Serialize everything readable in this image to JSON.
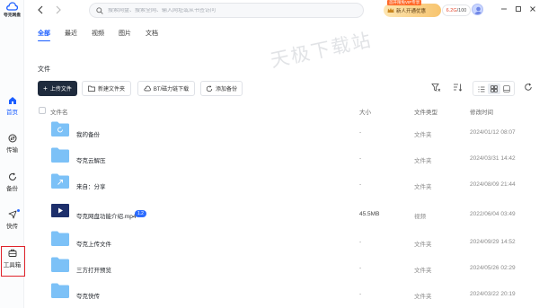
{
  "app": {
    "logo_text": "夸克网盘"
  },
  "sidebar": {
    "items": [
      {
        "label": "首页",
        "icon": "home-icon",
        "active": true
      },
      {
        "label": "传输",
        "icon": "transfer-icon"
      },
      {
        "label": "备份",
        "icon": "backup-icon"
      },
      {
        "label": "快传",
        "icon": "quick-send-icon"
      },
      {
        "label": "工具箱",
        "icon": "toolbox-icon"
      }
    ]
  },
  "topbar": {
    "search_placeholder": "搜索网盘、搜索全网、输入网址或从书签访问",
    "promo_tag": "首开限免VIP专享",
    "promo_label": "新人开通优惠",
    "storage_used": "6.2G",
    "storage_total": "/100"
  },
  "tabs": [
    "全部",
    "最近",
    "视频",
    "图片",
    "文档"
  ],
  "watermark": "天极下载站",
  "section_title": "文件",
  "actions": {
    "upload": "上传文件",
    "new_folder": "新建文件夹",
    "bt_download": "BT/磁力链下载",
    "add_backup": "添加备份"
  },
  "table": {
    "headers": {
      "name": "文件名",
      "size": "大小",
      "type": "文件类型",
      "time": "修改时间"
    },
    "rows": [
      {
        "name": "我的备份",
        "size": "-",
        "type": "文件夹",
        "time": "2024/01/12 08:07",
        "icon": "backup-folder-icon"
      },
      {
        "name": "夸克云解压",
        "size": "-",
        "type": "文件夹",
        "time": "2024/03/31 14:42",
        "icon": "folder-icon"
      },
      {
        "name": "来自：分享",
        "size": "-",
        "type": "文件夹",
        "time": "2024/08/09 21:44",
        "icon": "share-folder-icon"
      },
      {
        "name": "夸克网盘功能介绍.mp4",
        "size": "45.5MB",
        "type": "视频",
        "time": "2022/06/04 03:49",
        "icon": "video-file-icon",
        "badge": "1.2"
      },
      {
        "name": "夸克上传文件",
        "size": "-",
        "type": "文件夹",
        "time": "2024/09/29 14:52",
        "icon": "folder-icon"
      },
      {
        "name": "三方打开预览",
        "size": "-",
        "type": "文件夹",
        "time": "2024/05/26 02:29",
        "icon": "folder-icon"
      },
      {
        "name": "夸克快传",
        "size": "-",
        "type": "文件夹",
        "time": "2024/03/22 20:19",
        "icon": "folder-icon"
      }
    ]
  },
  "colors": {
    "accent": "#1a5dff",
    "dark_button": "#1f2b3d",
    "folder": "#7cc1f7",
    "highlight_box": "#e0232b"
  }
}
